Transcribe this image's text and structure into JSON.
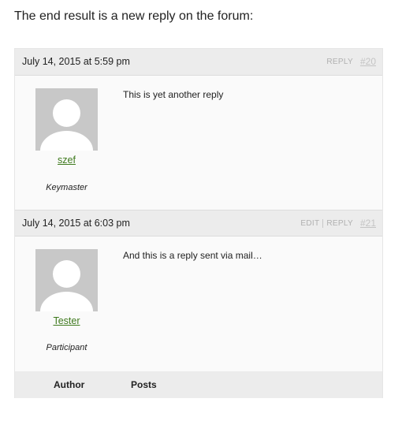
{
  "intro_text": "The end result is a new reply on the forum:",
  "replies": [
    {
      "date": "July 14, 2015 at 5:59 pm",
      "actions": [
        "REPLY"
      ],
      "permalink": "#20",
      "author": "szef",
      "role": "Keymaster",
      "content": "This is yet another reply"
    },
    {
      "date": "July 14, 2015 at 6:03 pm",
      "actions": [
        "EDIT",
        "REPLY"
      ],
      "permalink": "#21",
      "author": "Tester",
      "role": "Participant",
      "content": "And this is a reply sent via mail…"
    }
  ],
  "footer": {
    "author_label": "Author",
    "posts_label": "Posts"
  },
  "colors": {
    "link_green": "#3f7a1e",
    "header_gray": "#ececec",
    "avatar_gray": "#c8c8c8"
  }
}
